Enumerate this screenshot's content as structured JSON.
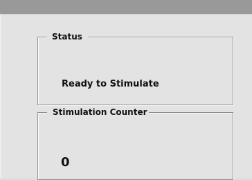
{
  "status": {
    "title": "Status",
    "value": "Ready to Stimulate"
  },
  "stimulation_counter": {
    "title": "Stimulation Counter",
    "value": "0"
  }
}
